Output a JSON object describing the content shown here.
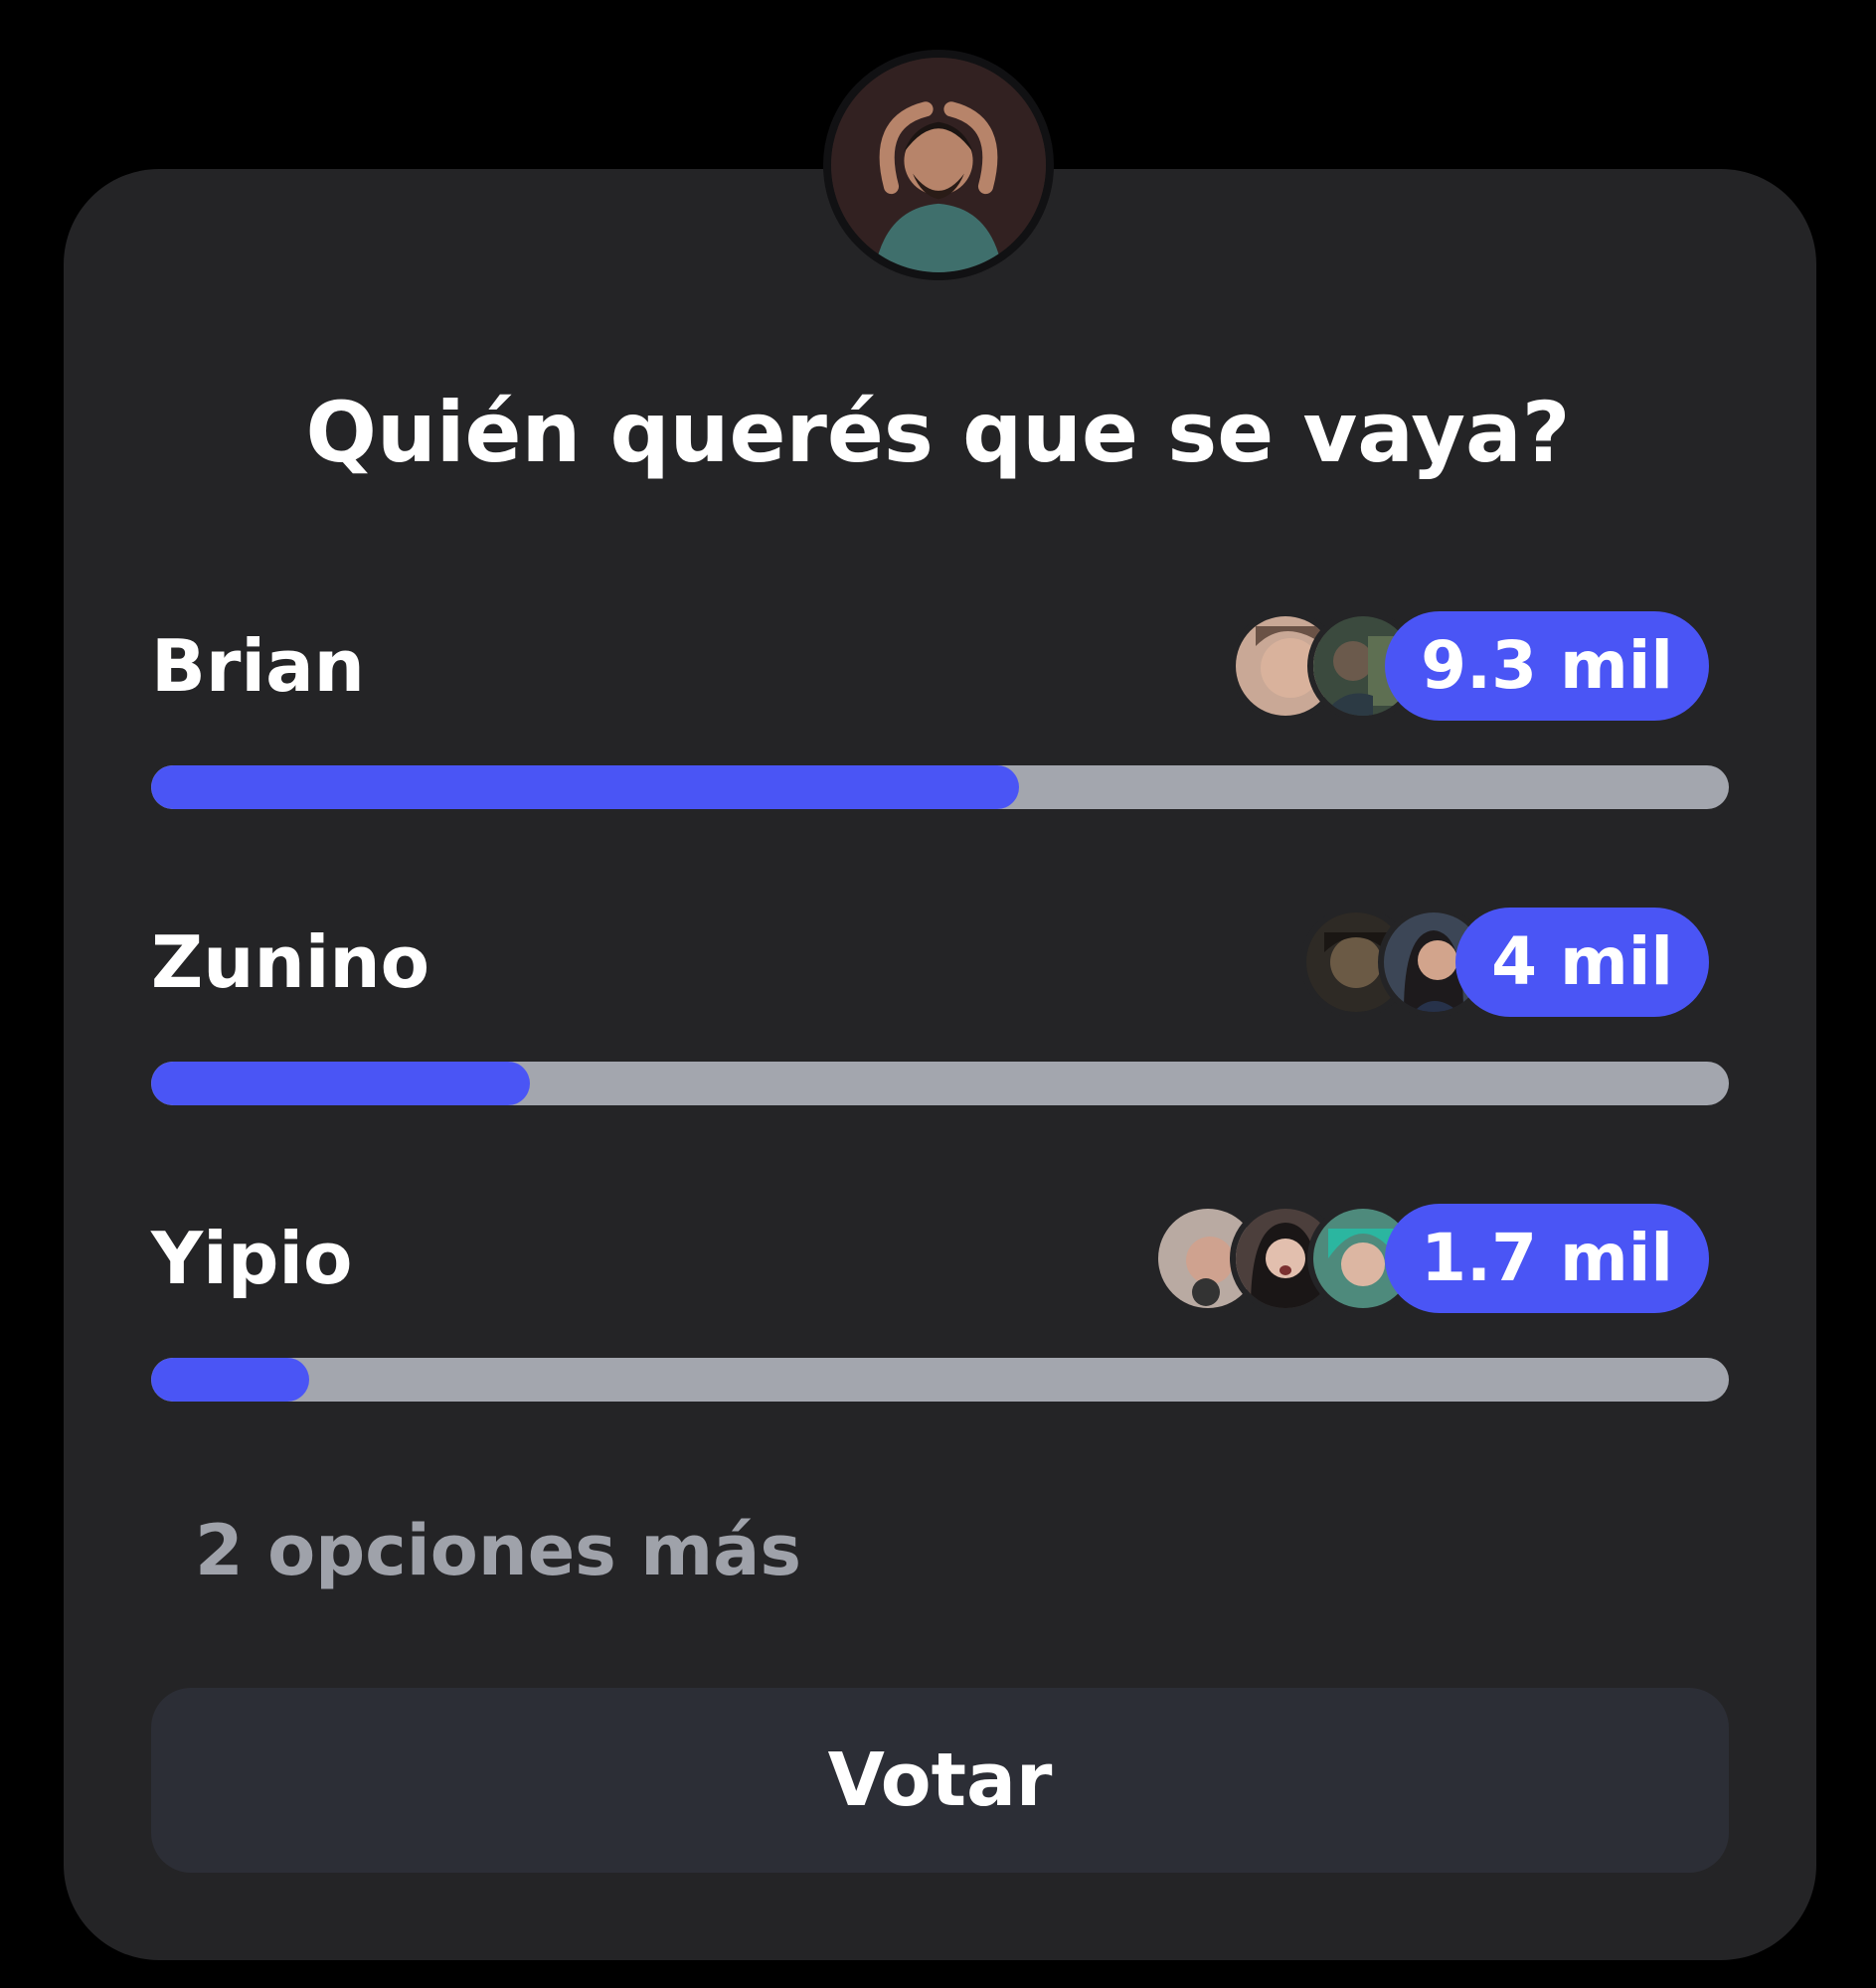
{
  "poll": {
    "question": "Quién querés que se vaya?",
    "options": [
      {
        "label": "Brian",
        "count": "9.3 mil",
        "fraction": 0.55
      },
      {
        "label": "Zunino",
        "count": "4 mil",
        "fraction": 0.24
      },
      {
        "label": "Yipio",
        "count": "1.7 mil",
        "fraction": 0.1
      }
    ],
    "more_options": "2 opciones más",
    "vote_label": "Votar"
  },
  "colors": {
    "background": "#000000",
    "card": "#242426",
    "accent": "#4a55f5",
    "track": "#a3a6ae",
    "muted_text": "#9fa2aa",
    "button": "#2c2e36"
  }
}
